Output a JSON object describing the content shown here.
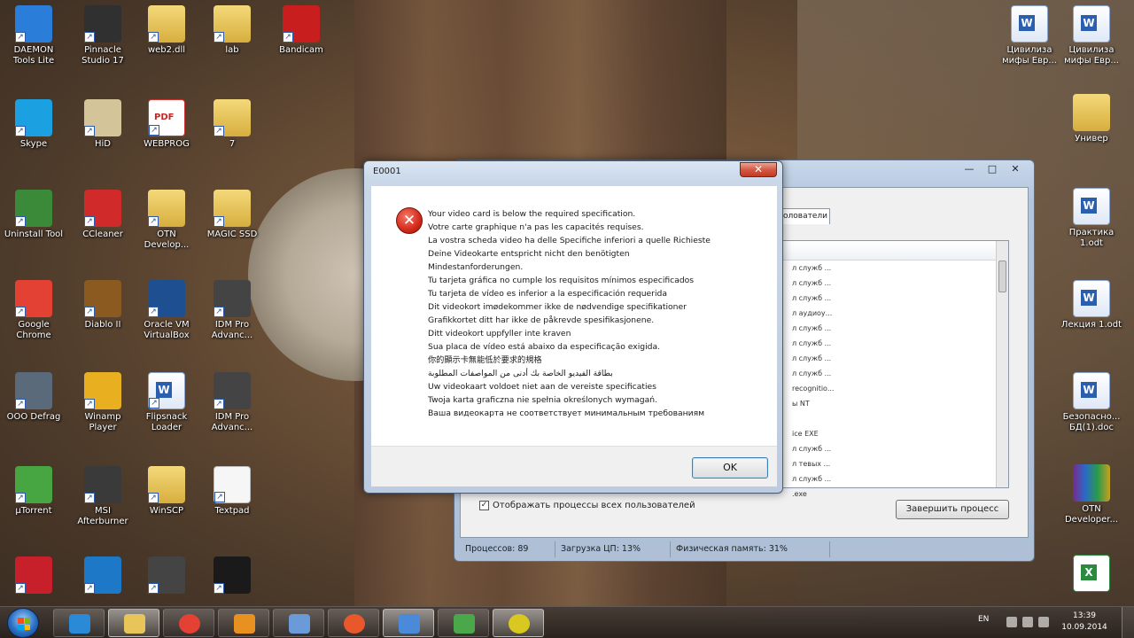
{
  "desktop": {
    "icons_left": [
      {
        "label": "DAEMON Tools Lite",
        "icon": "daemon-tools-icon",
        "color": "#2a7dd8"
      },
      {
        "label": "Pinnacle Studio 17",
        "icon": "pinnacle-studio-icon",
        "color": "#303030"
      },
      {
        "label": "web2.dll",
        "icon": "folder-icon",
        "color": "#e8c55a"
      },
      {
        "label": "lab",
        "icon": "folder-icon",
        "color": "#e8c55a"
      },
      {
        "label": "Bandicam",
        "icon": "bandicam-icon",
        "color": "#c81e1e"
      },
      {
        "label": "Skype",
        "icon": "skype-icon",
        "color": "#1ba1e2"
      },
      {
        "label": "HiD",
        "icon": "hid-icon",
        "color": "#d4c49a"
      },
      {
        "label": "WEBPROG",
        "icon": "pdf-icon",
        "color": "#cc2222"
      },
      {
        "label": "7",
        "icon": "folder-icon",
        "color": "#e8c55a"
      },
      {
        "label": "Uninstall Tool",
        "icon": "uninstall-tool-icon",
        "color": "#3a8a3a"
      },
      {
        "label": "CCleaner",
        "icon": "ccleaner-icon",
        "color": "#d02a2a"
      },
      {
        "label": "OTN Develop...",
        "icon": "folder-icon",
        "color": "#e8c55a"
      },
      {
        "label": "MAGIC SSD",
        "icon": "folder-icon",
        "color": "#e8c55a"
      },
      {
        "label": "Google Chrome",
        "icon": "chrome-icon",
        "color": "#e34133"
      },
      {
        "label": "Diablo II",
        "icon": "diablo-icon",
        "color": "#8a5a20"
      },
      {
        "label": "Oracle VM VirtualBox",
        "icon": "virtualbox-icon",
        "color": "#1d4f91"
      },
      {
        "label": "IDM Pro Advanc...",
        "icon": "idm-pro-icon",
        "color": "#444444"
      },
      {
        "label": "OOO Defrag",
        "icon": "defrag-icon",
        "color": "#5a6a7a"
      },
      {
        "label": "Winamp Player",
        "icon": "winamp-icon",
        "color": "#e8b020"
      },
      {
        "label": "Flipsnack Loader",
        "icon": "word-doc-icon",
        "color": "#2b5fae"
      },
      {
        "label": "IDM Pro Advanc...",
        "icon": "idm-pro-icon",
        "color": "#444444"
      },
      {
        "label": "µTorrent",
        "icon": "utorrent-icon",
        "color": "#47a641"
      },
      {
        "label": "MSI Afterburner",
        "icon": "msi-afterburner-icon",
        "color": "#3a3a3a"
      },
      {
        "label": "WinSCP",
        "icon": "folder-icon",
        "color": "#e8c55a"
      },
      {
        "label": "Textpad",
        "icon": "blank-doc-icon",
        "color": "#f0f0f0"
      },
      {
        "label": "",
        "icon": "aida64-icon",
        "color": "#c8202a"
      },
      {
        "label": "",
        "icon": "update-icon",
        "color": "#1e78c8"
      },
      {
        "label": "",
        "icon": "idm-pro-icon",
        "color": "#444444"
      },
      {
        "label": "",
        "icon": "pes15-icon",
        "color": "#1a1a1a"
      }
    ],
    "icons_right": [
      {
        "label": "Цивилиза мифы Евр...",
        "icon": "word-doc-icon"
      },
      {
        "label": "Цивилиза мифы Евр...",
        "icon": "word-doc-icon"
      },
      {
        "label": "Универ",
        "icon": "folder-icon"
      },
      {
        "label": "Практика 1.odt",
        "icon": "word-doc-icon"
      },
      {
        "label": "Лекция 1.odt",
        "icon": "word-doc-icon"
      },
      {
        "label": "Безопасно... БД(1).doc",
        "icon": "word-doc-icon"
      },
      {
        "label": "OTN Developer...",
        "icon": "winrar-icon"
      },
      {
        "label": "",
        "icon": "excel-doc-icon"
      }
    ]
  },
  "taskmgr": {
    "tab_label": "олователи",
    "rows": [
      "л служб ...",
      "л служб ...",
      "л служб ...",
      "л аудиоу...",
      "л служб ...",
      "л служб ...",
      "л служб ...",
      "л служб ...",
      "recognitio...",
      "ы NT",
      "",
      "ice EXE",
      "л служб ...",
      "л тевых ...",
      "л служб ...",
      ".exe"
    ],
    "show_all_label": "Отображать процессы всех пользователей",
    "end_process_label": "Завершить процесс",
    "status": {
      "processes": "Процессов: 89",
      "cpu": "Загрузка ЦП: 13%",
      "memory": "Физическая память: 31%"
    }
  },
  "dialog": {
    "title": "E0001",
    "close_glyph": "✕",
    "error_glyph": "✕",
    "lines": [
      "Your video card is below the required specification.",
      "Votre carte graphique n'a pas les capacités requises.",
      "La vostra scheda video ha delle Specifiche inferiori a quelle Richieste",
      "Deine Videokarte entspricht nicht den benötigten",
      "Mindestanforderungen.",
      "Tu tarjeta gráfica no cumple los requisitos mínimos especificados",
      "Tu tarjeta de vídeo es inferior a la especificación requerida",
      "Dit videokort imødekommer ikke de nødvendige specifikationer",
      "Grafikkortet ditt har ikke de påkrevde spesifikasjonene.",
      "Ditt videokort uppfyller inte kraven",
      "Sua placa de vídeo está abaixo da especificação exigida.",
      "你的顯示卡無能低於要求的規格",
      "بطاقة الفيديو الخاصة بك أدنى من المواصفات المطلوبة",
      "Uw videokaart voldoet niet aan de vereiste specificaties",
      "Twoja karta graficzna nie spełnia określonych wymagań.",
      "Ваша видеокарта не соответствует минимальным требованиям"
    ],
    "ok_label": "OK"
  },
  "taskbar": {
    "pinned": [
      {
        "name": "ie-icon",
        "color": "#2a8ad8"
      },
      {
        "name": "explorer-icon",
        "color": "#e8c55a",
        "active": true
      },
      {
        "name": "chrome-icon",
        "color": "#e34133"
      },
      {
        "name": "link-icon",
        "color": "#e89020"
      },
      {
        "name": "disk-icon",
        "color": "#6a9ad8"
      },
      {
        "name": "media-icon",
        "color": "#e8582a"
      },
      {
        "name": "taskmgr-icon",
        "color": "#4a8ad8",
        "active": true
      },
      {
        "name": "monitor-icon",
        "color": "#4aa84a"
      },
      {
        "name": "pes15-icon",
        "color": "#d8c820",
        "active": true
      }
    ],
    "lang": "EN",
    "time": "13:39",
    "date": "10.09.2014"
  }
}
